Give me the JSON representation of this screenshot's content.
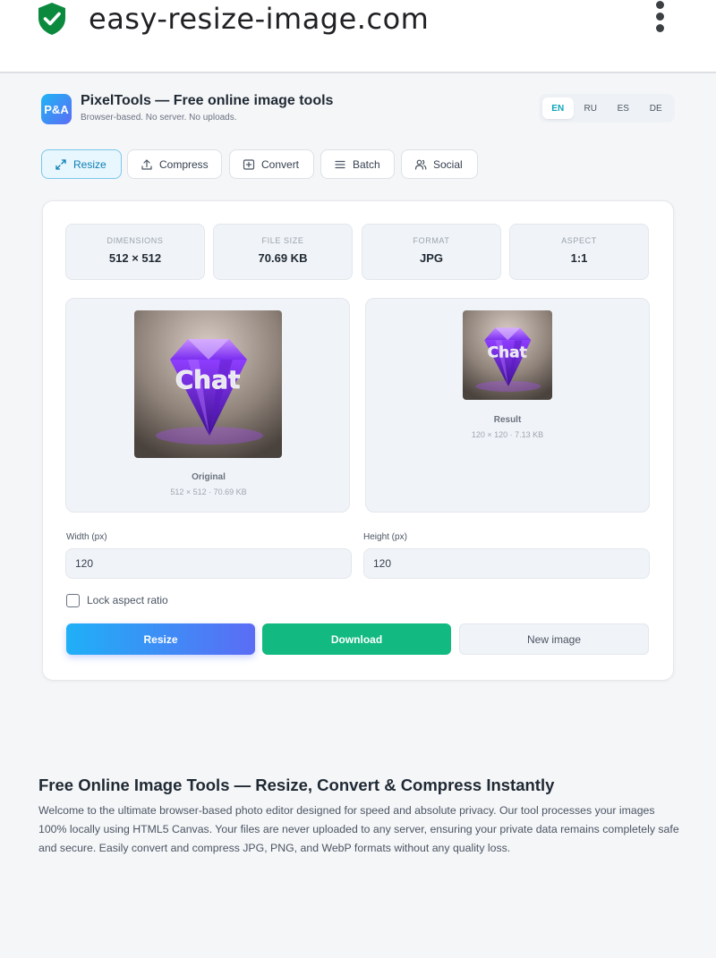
{
  "browser": {
    "url": "easy-resize-image.com"
  },
  "app": {
    "logo_text": "P&A",
    "title": "PixelTools — Free online image tools",
    "subtitle": "Browser-based. No server. No uploads."
  },
  "languages": [
    {
      "label": "EN",
      "active": true
    },
    {
      "label": "RU",
      "active": false
    },
    {
      "label": "ES",
      "active": false
    },
    {
      "label": "DE",
      "active": false
    }
  ],
  "tabs": [
    {
      "label": "Resize",
      "icon": "expand-arrows-icon",
      "active": true
    },
    {
      "label": "Compress",
      "icon": "upload-icon",
      "active": false
    },
    {
      "label": "Convert",
      "icon": "convert-icon",
      "active": false
    },
    {
      "label": "Batch",
      "icon": "list-icon",
      "active": false
    },
    {
      "label": "Social",
      "icon": "users-icon",
      "active": false
    }
  ],
  "stats": [
    {
      "label": "DIMENSIONS",
      "value": "512 × 512"
    },
    {
      "label": "FILE SIZE",
      "value": "70.69 KB"
    },
    {
      "label": "FORMAT",
      "value": "JPG"
    },
    {
      "label": "ASPECT",
      "value": "1:1"
    }
  ],
  "preview": {
    "original": {
      "title": "Original",
      "meta": "512 × 512 · 70.69 KB",
      "image_text": "Chat"
    },
    "result": {
      "title": "Result",
      "meta": "120 × 120 · 7.13 KB",
      "image_text": "Chat"
    }
  },
  "form": {
    "width_label": "Width (px)",
    "width_value": "120",
    "height_label": "Height (px)",
    "height_value": "120",
    "lock_label": "Lock aspect ratio",
    "lock_checked": false
  },
  "actions": {
    "resize": "Resize",
    "download": "Download",
    "new_image": "New image"
  },
  "article": {
    "title": "Free Online Image Tools — Resize, Convert & Compress Instantly",
    "body": "Welcome to the ultimate browser-based photo editor designed for speed and absolute privacy. Our tool processes your images 100% locally using HTML5 Canvas. Your files are never uploaded to any server, ensuring your private data remains completely safe and secure. Easily convert and compress JPG, PNG, and WebP formats without any quality loss."
  },
  "colors": {
    "accent_gradient_start": "#1fb0f7",
    "accent_gradient_end": "#5b6cf5",
    "download_green": "#12b981",
    "shield_green": "#0b8a3e"
  }
}
